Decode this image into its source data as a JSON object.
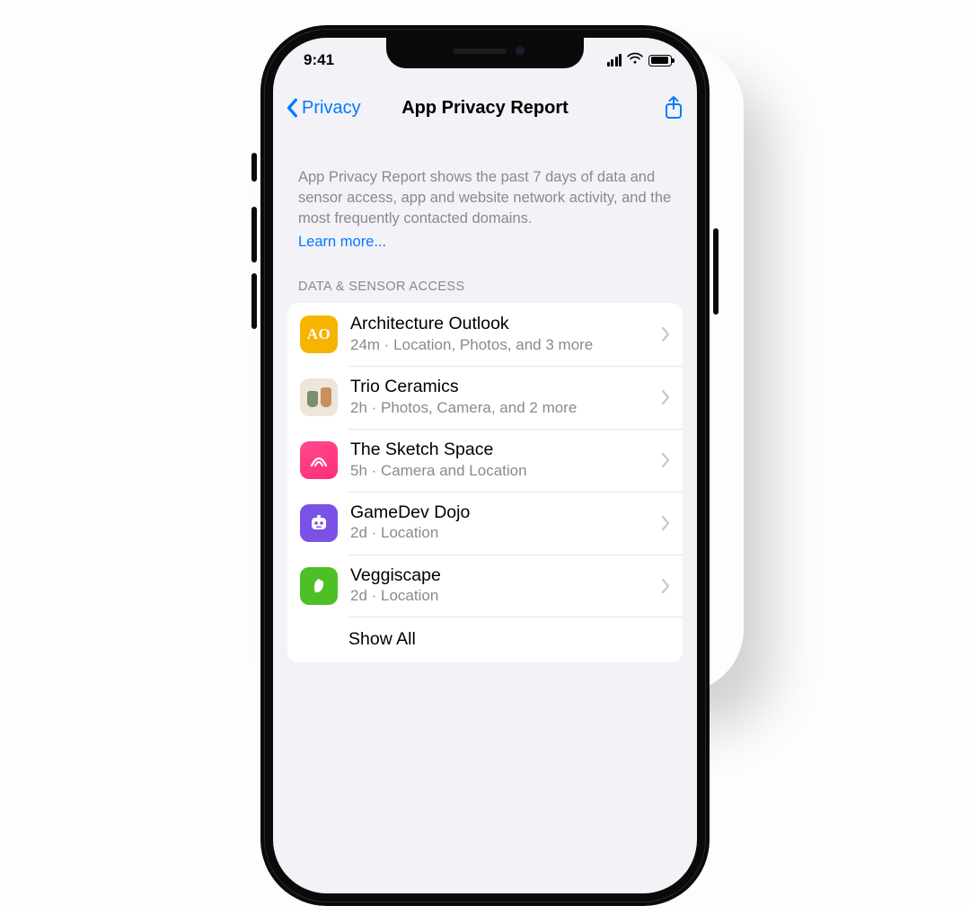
{
  "status": {
    "time": "9:41"
  },
  "nav": {
    "back_label": "Privacy",
    "title": "App Privacy Report"
  },
  "intro": {
    "text": "App Privacy Report shows the past 7 days of data and sensor access, app and website network activity, and the most frequently contacted domains.",
    "learn_more": "Learn more..."
  },
  "section": {
    "header": "DATA & SENSOR ACCESS",
    "apps": [
      {
        "name": "Architecture Outlook",
        "sub": "24m · Location, Photos, and 3 more",
        "icon": "ao",
        "iconText": "AO"
      },
      {
        "name": "Trio Ceramics",
        "sub": "2h · Photos, Camera, and 2 more",
        "icon": "trio",
        "iconText": ""
      },
      {
        "name": "The Sketch Space",
        "sub": "5h · Camera and Location",
        "icon": "sketch",
        "iconText": ""
      },
      {
        "name": "GameDev Dojo",
        "sub": "2d · Location",
        "icon": "gamedev",
        "iconText": ""
      },
      {
        "name": "Veggiscape",
        "sub": "2d · Location",
        "icon": "veg",
        "iconText": ""
      }
    ],
    "show_all": "Show All"
  }
}
